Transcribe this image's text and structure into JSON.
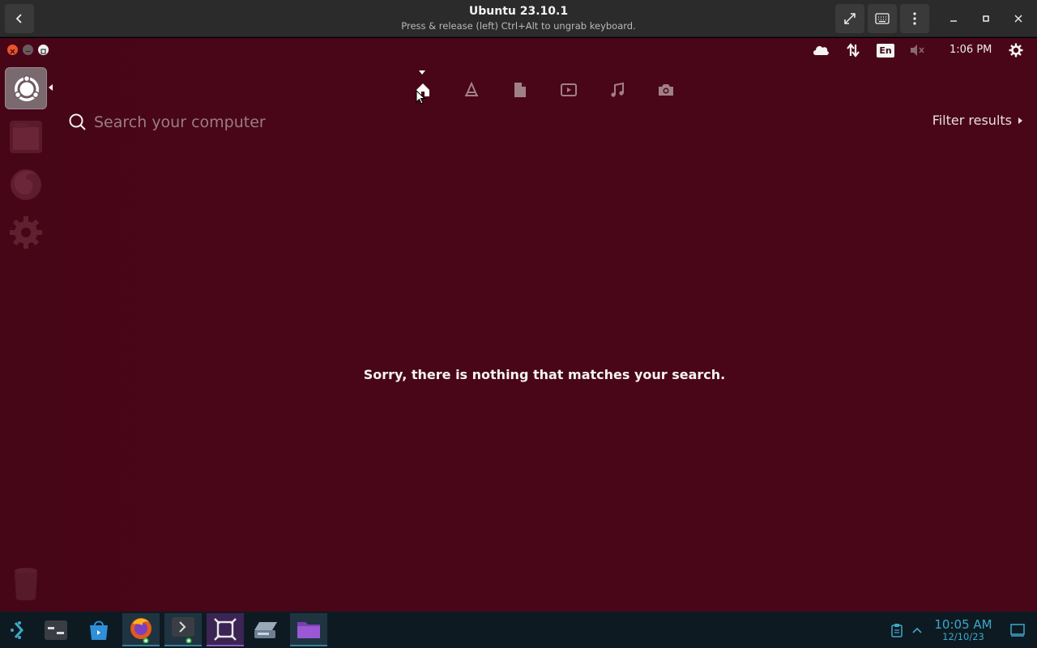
{
  "vm_window": {
    "title": "Ubuntu 23.10.1",
    "subtitle": "Press & release (left) Ctrl+Alt to ungrab keyboard."
  },
  "panel": {
    "clock": "1:06 PM",
    "keyboard_layout": "En"
  },
  "dash": {
    "lenses": [
      "home-icon",
      "applications-icon",
      "files-icon",
      "video-icon",
      "music-icon",
      "photo-icon"
    ],
    "search": {
      "placeholder": "Search your computer",
      "value": ""
    },
    "filter_label": "Filter results",
    "empty_message": "Sorry, there is nothing that matches your search."
  },
  "launcher": {
    "items": [
      "ubuntu-dash-icon",
      "files-icon",
      "firefox-icon",
      "settings-icon",
      "trash-icon"
    ]
  },
  "taskbar": {
    "time": "10:05 AM",
    "date": "12/10/23",
    "items": [
      "app-launcher-icon",
      "system-settings-icon",
      "discover-store-icon",
      "firefox-icon",
      "terminal-icon",
      "vm-manager-icon",
      "scanner-icon",
      "folder-icon"
    ]
  },
  "colors": {
    "guest_background": "#4a0619",
    "taskbar_background": "#0e1a22",
    "taskbar_accent": "#3ea8c9"
  }
}
